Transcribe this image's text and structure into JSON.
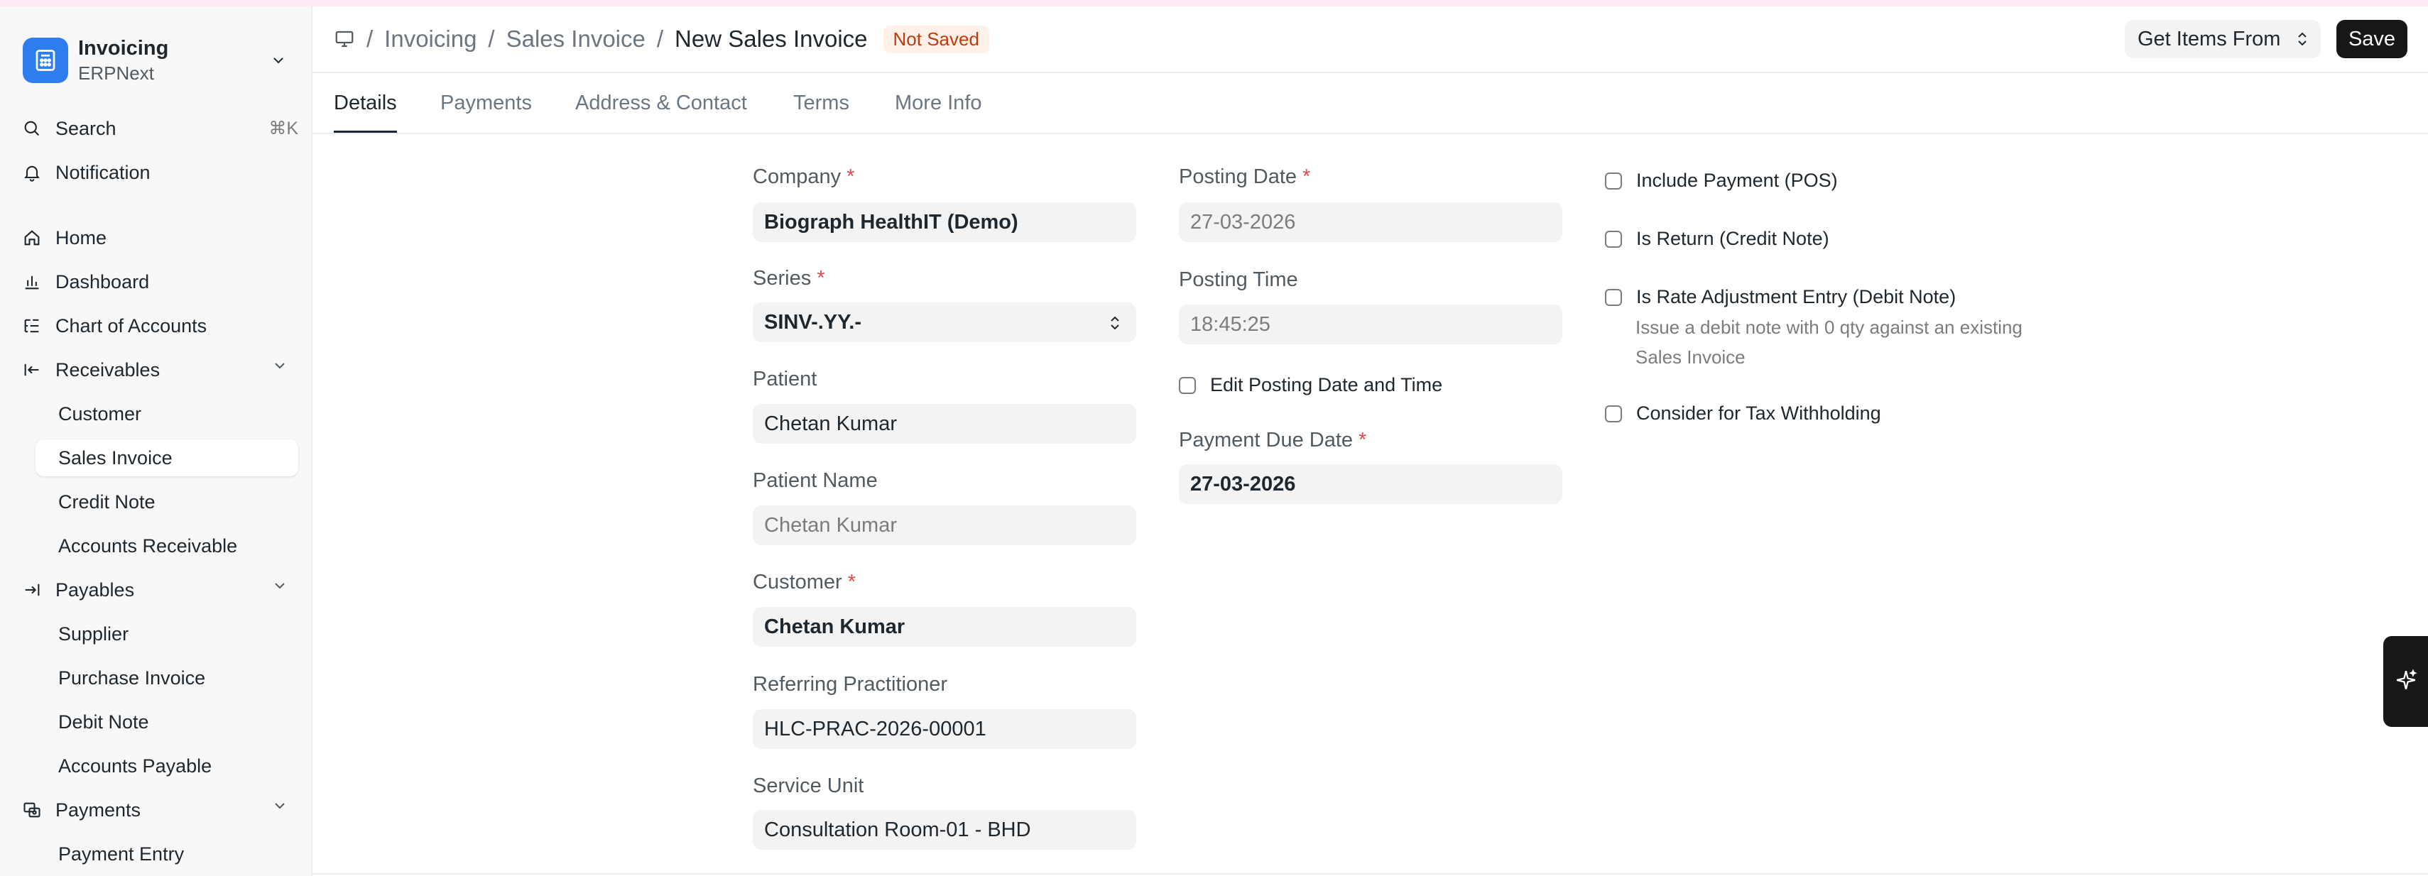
{
  "app": {
    "title": "Invoicing",
    "subtitle": "ERPNext"
  },
  "sidebar": {
    "search_label": "Search",
    "search_shortcut": "⌘K",
    "notification_label": "Notification",
    "items": {
      "home": "Home",
      "dashboard": "Dashboard",
      "chart_of_accounts": "Chart of Accounts",
      "receivables": "Receivables",
      "customer": "Customer",
      "sales_invoice": "Sales Invoice",
      "credit_note": "Credit Note",
      "accounts_receivable": "Accounts Receivable",
      "payables": "Payables",
      "supplier": "Supplier",
      "purchase_invoice": "Purchase Invoice",
      "debit_note": "Debit Note",
      "accounts_payable": "Accounts Payable",
      "payments": "Payments",
      "payment_entry": "Payment Entry"
    }
  },
  "header": {
    "breadcrumb": [
      "Invoicing",
      "Sales Invoice",
      "New Sales Invoice"
    ],
    "separator": "/",
    "status_badge": "Not Saved",
    "get_items_label": "Get Items From",
    "save_label": "Save"
  },
  "tabs": [
    "Details",
    "Payments",
    "Address & Contact",
    "Terms",
    "More Info"
  ],
  "form": {
    "required_mark": "*",
    "company": {
      "label": "Company",
      "value": "Biograph HealthIT (Demo)"
    },
    "series": {
      "label": "Series",
      "value": "SINV-.YY.-"
    },
    "patient": {
      "label": "Patient",
      "value": "Chetan Kumar"
    },
    "patient_name": {
      "label": "Patient Name",
      "value": "Chetan Kumar"
    },
    "customer": {
      "label": "Customer",
      "value": "Chetan Kumar"
    },
    "referring_practitioner": {
      "label": "Referring Practitioner",
      "value": "HLC-PRAC-2026-00001"
    },
    "service_unit": {
      "label": "Service Unit",
      "value": "Consultation Room-01 - BHD"
    },
    "posting_date": {
      "label": "Posting Date",
      "value": "27-03-2026"
    },
    "posting_time": {
      "label": "Posting Time",
      "value": "18:45:25"
    },
    "edit_posting": {
      "label": "Edit Posting Date and Time",
      "checked": false
    },
    "payment_due_date": {
      "label": "Payment Due Date",
      "value": "27-03-2026"
    },
    "include_payment": {
      "label": "Include Payment (POS)",
      "checked": false
    },
    "is_return": {
      "label": "Is Return (Credit Note)",
      "checked": false
    },
    "is_rate_adjustment": {
      "label": "Is Rate Adjustment Entry (Debit Note)",
      "checked": false,
      "help": "Issue a debit note with 0 qty against an existing Sales Invoice"
    },
    "tax_withholding": {
      "label": "Consider for Tax Withholding",
      "checked": false
    }
  },
  "colors": {
    "accent": "#2f7ef0",
    "required": "#e24c4c",
    "badge_text": "#bc3c0f",
    "badge_bg": "#fff1e7",
    "primary_button": "#171717"
  }
}
